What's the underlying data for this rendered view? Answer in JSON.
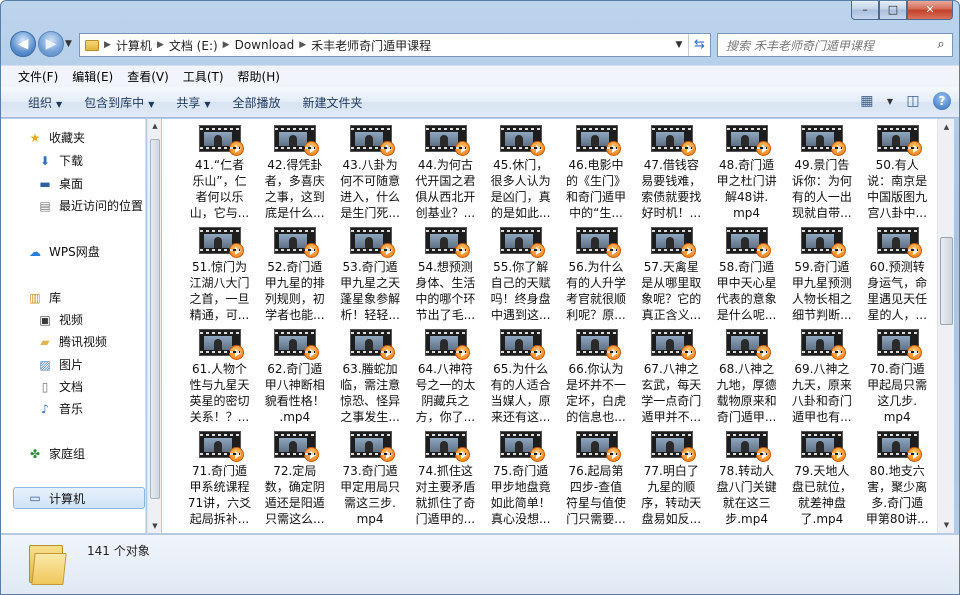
{
  "window": {
    "min": "–",
    "max": "□",
    "close": "✕"
  },
  "nav": {
    "back": "◀",
    "forward": "▶"
  },
  "address": {
    "crumbs": [
      "计算机",
      "文档 (E:)",
      "Download",
      "禾丰老师奇门遁甲课程"
    ]
  },
  "search": {
    "placeholder": "搜索 禾丰老师奇门遁甲课程"
  },
  "menu": [
    "文件(F)",
    "编辑(E)",
    "查看(V)",
    "工具(T)",
    "帮助(H)"
  ],
  "toolbar": {
    "organize": "组织",
    "include": "包含到库中",
    "share": "共享",
    "playall": "全部播放",
    "newfolder": "新建文件夹"
  },
  "sidebar": {
    "favorites": "收藏夹",
    "downloads": "下载",
    "desktop": "桌面",
    "recent": "最近访问的位置",
    "wps": "WPS网盘",
    "library": "库",
    "videos": "视频",
    "tencent": "腾讯视频",
    "pictures": "图片",
    "documents": "文档",
    "music": "音乐",
    "homegroup": "家庭组",
    "computer": "计算机"
  },
  "files": [
    [
      "41.“仁者",
      "乐山”，仁",
      "者何以乐",
      "山，它与..."
    ],
    [
      "42.得凭卦",
      "者，多喜庆",
      "之事，这到",
      "底是什么..."
    ],
    [
      "43.八卦为",
      "何不可随意",
      "进入，什么",
      "是生门死..."
    ],
    [
      "44.为何古",
      "代开国之君",
      "俱从西北开",
      "创基业？..."
    ],
    [
      "45.休门，",
      "很多人认为",
      "是凶门，真",
      "的是如此..."
    ],
    [
      "46.电影中",
      "的《生门》",
      "和奇门遁甲",
      "中的“生..."
    ],
    [
      "47.借钱容",
      "易要钱难，",
      "索债就要找",
      "好时机！..."
    ],
    [
      "48.奇门遁",
      "甲之杜门讲",
      "解48讲.",
      "mp4"
    ],
    [
      "49.景门告",
      "诉你：为何",
      "有的人一出",
      "现就自带..."
    ],
    [
      "50.有人",
      "说：南京是",
      "中国版图九",
      "宫八卦中..."
    ],
    [
      "51.惊门为",
      "江湖八大门",
      "之首，一旦",
      "精通，可..."
    ],
    [
      "52.奇门遁",
      "甲九星的排",
      "列规则，初",
      "学者也能..."
    ],
    [
      "53.奇门遁",
      "甲九星之天",
      "蓬星象参解",
      "析！轻轻..."
    ],
    [
      "54.想预测",
      "身体、生活",
      "中的哪个环",
      "节出了毛..."
    ],
    [
      "55.你了解",
      "自己的天赋",
      "吗！终身盘",
      "中遇到这..."
    ],
    [
      "56.为什么",
      "有的人升学",
      "考官就很顺",
      "利呢？原..."
    ],
    [
      "57.天禽星",
      "是从哪里取",
      "象呢？它的",
      "真正含义..."
    ],
    [
      "58.奇门遁",
      "甲中天心星",
      "代表的意象",
      "是什么呢..."
    ],
    [
      "59.奇门遁",
      "甲九星预测",
      "人物长相之",
      "细节判断..."
    ],
    [
      "60.预测转",
      "身运气，命",
      "里遇见天任",
      "星的人，..."
    ],
    [
      "61.人物个",
      "性与九星天",
      "英星的密切",
      "关系！？..."
    ],
    [
      "62.奇门遁",
      "甲八神断相",
      "貌看性格！",
      ".mp4"
    ],
    [
      "63.螣蛇加",
      "临，需注意",
      "惊恐、怪异",
      "之事发生..."
    ],
    [
      "64.八神符",
      "号之一的太",
      "阴藏兵之",
      "方，你了..."
    ],
    [
      "65.为什么",
      "有的人适合",
      "当媒人，原",
      "来还有这..."
    ],
    [
      "66.你认为",
      "是坏并不一",
      "定坏，白虎",
      "的信息也..."
    ],
    [
      "67.八神之",
      "玄武，每天",
      "学一点奇门",
      "遁甲并不..."
    ],
    [
      "68.八神之",
      "九地，厚德",
      "载物原来和",
      "奇门遁甲..."
    ],
    [
      "69.八神之",
      "九天，原来",
      "八卦和奇门",
      "遁甲也有..."
    ],
    [
      "70.奇门遁",
      "甲起局只需",
      "这几步.",
      "mp4"
    ],
    [
      "71.奇门遁",
      "甲系统课程",
      "71讲，六爻",
      "起局拆补..."
    ],
    [
      "72.定局",
      "数，确定阴",
      "遁还是阳遁",
      "只需这么..."
    ],
    [
      "73.奇门遁",
      "甲定用局只",
      "需这三步.",
      "mp4"
    ],
    [
      "74.抓住这",
      "对主要矛盾",
      "就抓住了奇",
      "门遁甲的..."
    ],
    [
      "75.奇门遁",
      "甲步地盘竟",
      "如此简单！",
      "真心没想..."
    ],
    [
      "76.起局第",
      "四步-查值",
      "符星与值使",
      "门只需要..."
    ],
    [
      "77.明白了",
      "九星的顺",
      "序，转动天",
      "盘易如反..."
    ],
    [
      "78.转动人",
      "盘八门关键",
      "就在这三",
      "步.mp4"
    ],
    [
      "79.天地人",
      "盘已就位，",
      "就差神盘",
      "了.mp4"
    ],
    [
      "80.地支六",
      "害，聚少离",
      "多.奇门遁",
      "甲第80讲..."
    ]
  ],
  "status": {
    "count": "141 个对象"
  },
  "icons": {
    "folder": "folder-icon",
    "video": "video-file-icon",
    "search": "search-icon",
    "refresh": "refresh-icon"
  }
}
